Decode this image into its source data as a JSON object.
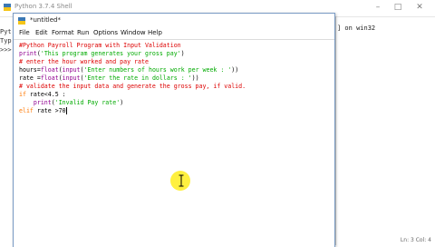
{
  "shell": {
    "title": "Python 3.7.4 Shell",
    "left_lines": [
      "Pyt",
      "Typ",
      ">>>"
    ],
    "right_text": "] on win32",
    "status": "Ln: 3  Col: 4"
  },
  "editor": {
    "title": "*untitled*",
    "menu": [
      "File",
      "Edit",
      "Format",
      "Run",
      "Options",
      "Window",
      "Help"
    ]
  },
  "code": {
    "l1": "#Python Payroll Program with Input Validation",
    "l2_fn": "print",
    "l2_str": "'This program generates your gross pay'",
    "l3": "# enter the hour worked and pay rate",
    "l4_pre": "hours=",
    "l4_fn1": "float",
    "l4_mid": "(",
    "l4_fn2": "input",
    "l4_str": "'Enter numbers of hours work per week : '",
    "l4_end": "))",
    "l5_pre": "rate =",
    "l5_fn1": "float",
    "l5_mid": "(",
    "l5_fn2": "input",
    "l5_str": "'Enter the rate in dollars : '",
    "l5_end": "))",
    "l6": "# validate the input data and generate the gross pay, if valid.",
    "l7_kw": "if",
    "l7_rest": " rate<4.5 :",
    "l8_fn": "print",
    "l8_str": "'Invalid Pay rate'",
    "l9_kw": "elif",
    "l9_rest": " rate >70"
  }
}
